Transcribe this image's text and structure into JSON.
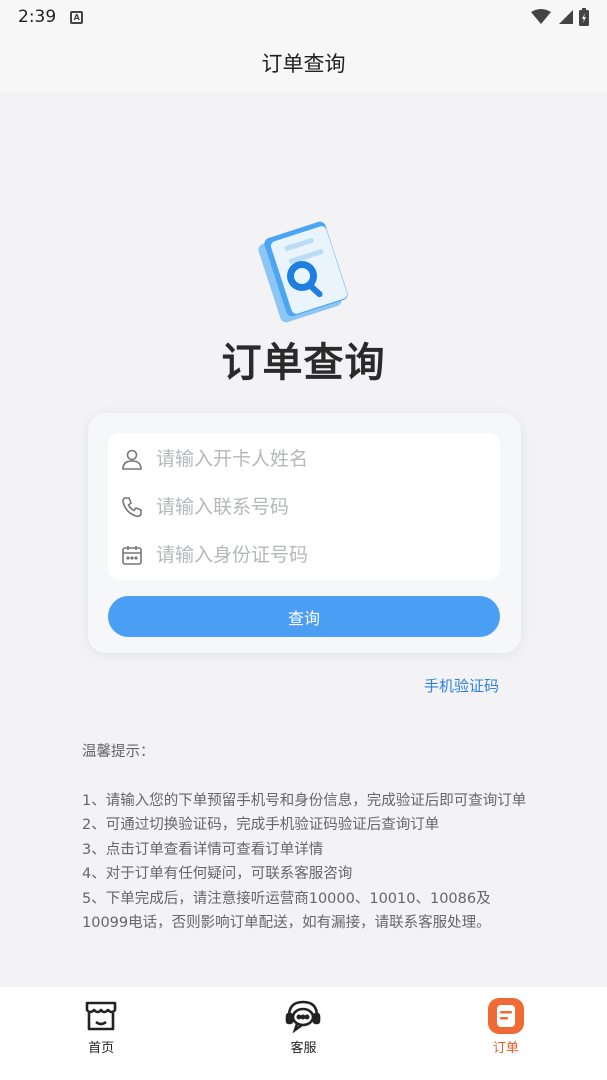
{
  "status_bar": {
    "time": "2:39",
    "badge": "A"
  },
  "header": {
    "title": "订单查询"
  },
  "hero": {
    "title": "订单查询"
  },
  "form": {
    "name_placeholder": "请输入开卡人姓名",
    "phone_placeholder": "请输入联系号码",
    "id_placeholder": "请输入身份证号码",
    "query_label": "查询"
  },
  "sms_link": "手机验证码",
  "tips": {
    "title": "温馨提示：",
    "items": [
      "1、请输入您的下单预留手机号和身份信息，完成验证后即可查询订单",
      "2、可通过切换验证码，完成手机验证码验证后查询订单",
      "3、点击订单查看详情可查看订单详情",
      "4、对于订单有任何疑问，可联系客服咨询",
      "5、下单完成后，请注意接听运营商10000、10010、10086及10099电话，否则影响订单配送，如有漏接，请联系客服处理。"
    ]
  },
  "tabbar": {
    "home": "首页",
    "service": "客服",
    "orders": "订单"
  },
  "colors": {
    "accent": "#4a9ef4",
    "link": "#2f7fe0",
    "tab_active": "#ee5a2a"
  }
}
